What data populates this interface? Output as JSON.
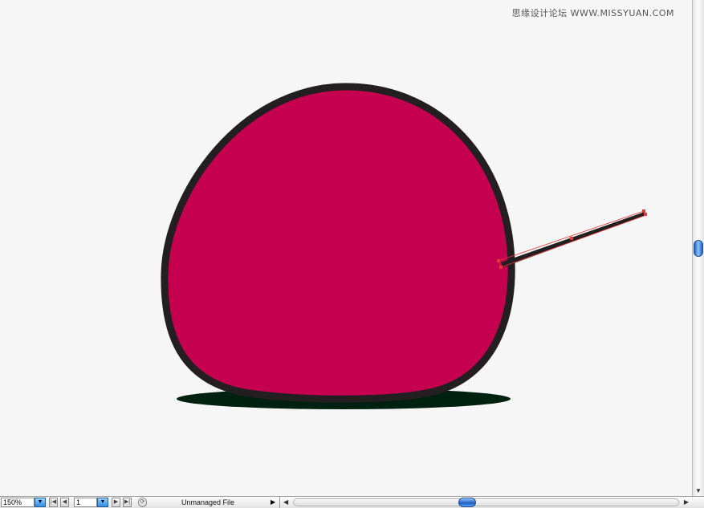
{
  "watermark": "思缘设计论坛 WWW.MISSYUAN.COM",
  "statusbar": {
    "zoom": "150%",
    "page": "1",
    "file_status": "Unmanaged File"
  },
  "artwork": {
    "body_fill": "#c4004f",
    "body_stroke": "#231f20",
    "shadow_fill": "#002010",
    "stem_stroke": "#231f20",
    "selection_color": "#e03a3a"
  },
  "icons": {
    "zoom_dropdown": "triangle-down-icon",
    "first_page": "first-page-icon",
    "prev_page": "prev-page-icon",
    "page_dropdown": "triangle-down-icon",
    "next_page": "next-page-icon",
    "last_page": "last-page-icon",
    "rotate": "rotate-icon",
    "scroll_left": "triangle-left-icon",
    "scroll_right": "triangle-right-icon",
    "scroll_down": "triangle-down-icon"
  }
}
